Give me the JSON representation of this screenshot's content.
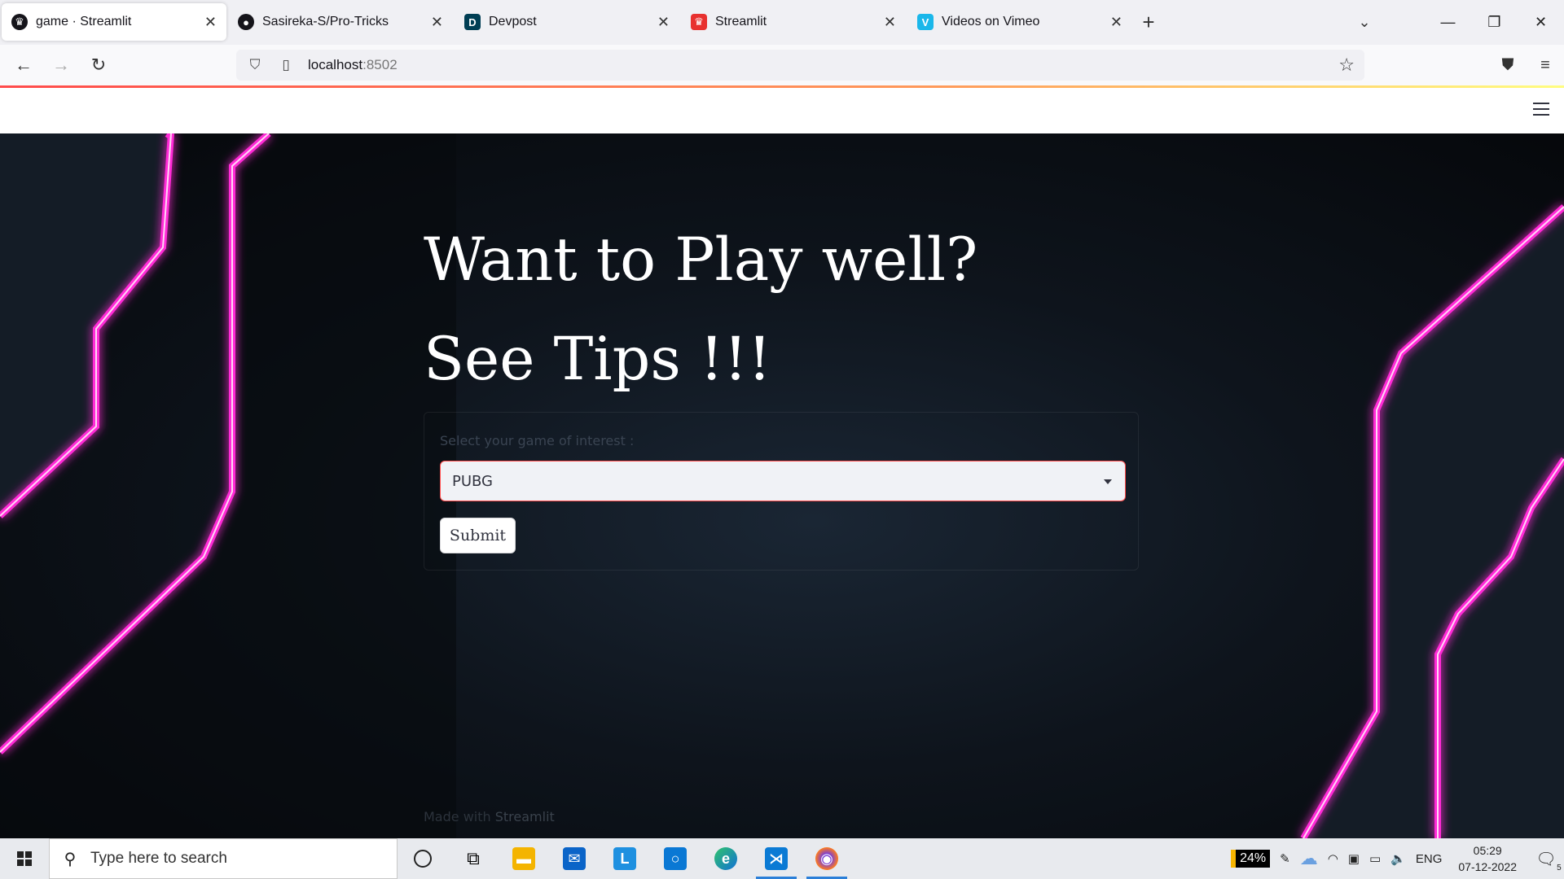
{
  "browser": {
    "tabs": [
      {
        "label": "game · Streamlit",
        "icon": "streamlit-crown-icon",
        "active": true
      },
      {
        "label": "Sasireka-S/Pro-Tricks",
        "icon": "github-icon",
        "active": false
      },
      {
        "label": "Devpost",
        "icon": "devpost-icon",
        "active": false
      },
      {
        "label": "Streamlit",
        "icon": "streamlit-icon",
        "active": false
      },
      {
        "label": "Videos on Vimeo",
        "icon": "vimeo-icon",
        "active": false
      }
    ],
    "url_host": "localhost",
    "url_port": ":8502"
  },
  "page": {
    "title": "Want to Play well? See Tips !!!",
    "select_label": "Select your game of interest :",
    "select_value": "PUBG",
    "submit_label": "Submit",
    "footer_prefix": "Made with ",
    "footer_brand": "Streamlit"
  },
  "taskbar": {
    "search_placeholder": "Type here to search",
    "battery": "24%",
    "language": "ENG",
    "time": "05:29",
    "date": "07-12-2022",
    "notifications": "5"
  },
  "colors": {
    "accent": "#ff4b4b",
    "neon": "#ff2bd6",
    "background": "#0b1017"
  }
}
